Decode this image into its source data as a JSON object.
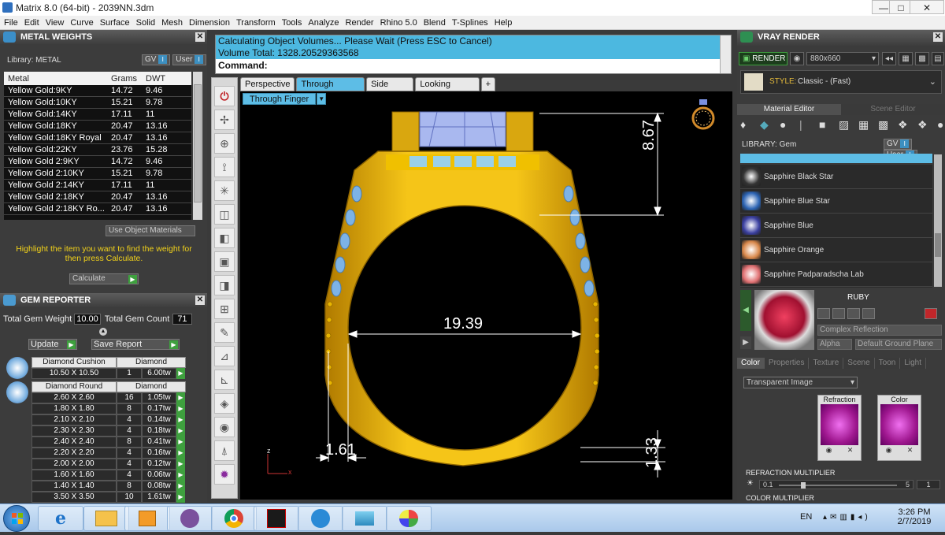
{
  "window": {
    "title": "Matrix 8.0 (64-bit) - 2039NN.3dm",
    "min": "—",
    "max": "□",
    "close": "✕"
  },
  "menu": [
    "File",
    "Edit",
    "View",
    "Curve",
    "Surface",
    "Solid",
    "Mesh",
    "Dimension",
    "Transform",
    "Tools",
    "Analyze",
    "Render",
    "Rhino 5.0",
    "Blend",
    "T-Splines",
    "Help"
  ],
  "metal_weights": {
    "title": "METAL WEIGHTS",
    "library_label": "Library: METAL",
    "gv": "GV",
    "user": "User",
    "headers": [
      "Metal",
      "Grams",
      "DWT"
    ],
    "rows": [
      [
        "Yellow Gold:9KY",
        "14.72",
        "9.46"
      ],
      [
        "Yellow Gold:10KY",
        "15.21",
        "9.78"
      ],
      [
        "Yellow Gold:14KY",
        "17.11",
        "11"
      ],
      [
        "Yellow Gold:18KY",
        "20.47",
        "13.16"
      ],
      [
        "Yellow Gold:18KY Royal",
        "20.47",
        "13.16"
      ],
      [
        "Yellow Gold:22KY",
        "23.76",
        "15.28"
      ],
      [
        "Yellow Gold 2:9KY",
        "14.72",
        "9.46"
      ],
      [
        "Yellow Gold 2:10KY",
        "15.21",
        "9.78"
      ],
      [
        "Yellow Gold 2:14KY",
        "17.11",
        "11"
      ],
      [
        "Yellow Gold 2:18KY",
        "20.47",
        "13.16"
      ],
      [
        "Yellow Gold 2:18KY Ro...",
        "20.47",
        "13.16"
      ]
    ],
    "use_object_materials": "Use Object Materials",
    "hint": "Highlight the item you want to find the weight for then press Calculate.",
    "calculate": "Calculate"
  },
  "gem_reporter": {
    "title": "GEM REPORTER",
    "total_weight_label": "Total Gem Weight",
    "total_weight": "10.00",
    "total_count_label": "Total Gem Count",
    "total_count": "71",
    "update": "Update",
    "save_report": "Save Report",
    "cushion_header": [
      "Diamond Cushion",
      "Diamond"
    ],
    "cushion_row": [
      "10.50 X 10.50",
      "1",
      "6.00tw"
    ],
    "round_header": [
      "Diamond Round",
      "Diamond"
    ],
    "round_rows": [
      [
        "2.60 X 2.60",
        "16",
        "1.05tw"
      ],
      [
        "1.80 X 1.80",
        "8",
        "0.17tw"
      ],
      [
        "2.10 X 2.10",
        "4",
        "0.14tw"
      ],
      [
        "2.30 X 2.30",
        "4",
        "0.18tw"
      ],
      [
        "2.40 X 2.40",
        "8",
        "0.41tw"
      ],
      [
        "2.20 X 2.20",
        "4",
        "0.16tw"
      ],
      [
        "2.00 X 2.00",
        "4",
        "0.12tw"
      ],
      [
        "1.60 X 1.60",
        "4",
        "0.06tw"
      ],
      [
        "1.40 X 1.40",
        "8",
        "0.08tw"
      ],
      [
        "3.50 X 3.50",
        "10",
        "1.61tw"
      ]
    ]
  },
  "command": {
    "line1": "Calculating Object Volumes... Please Wait (Press ESC to Cancel)",
    "line2": "Volume Total: 1328.20529363568",
    "prompt": "Command:"
  },
  "viewport": {
    "tabs": [
      "Perspective",
      "Through Finger",
      "Side View",
      "Looking Down"
    ],
    "add_tab": "+",
    "label": "Through Finger",
    "dims": {
      "top": "8.67",
      "inner": "19.39",
      "left": "1.61",
      "bottom": "1.33"
    },
    "axis_z": "z",
    "axis_x": "x"
  },
  "vray": {
    "title": "VRAY RENDER",
    "render": "RENDER",
    "size": "880x660",
    "style_label": "STYLE:",
    "style_value": "Classic - (Fast)",
    "tab_material": "Material Editor",
    "tab_scene": "Scene Editor",
    "library_label": "LIBRARY: Gem",
    "gv": "GV",
    "user": "User",
    "materials": [
      "Sapphire Black Star",
      "Sapphire Blue Star",
      "Sapphire Blue",
      "Sapphire Orange",
      "Sapphire Padparadscha Lab"
    ],
    "selected_title": "RUBY",
    "complex_reflection": "Complex Reflection",
    "alpha": "Alpha",
    "ground": "Default Ground Plane",
    "prop_tabs": [
      "Color",
      "Properties",
      "Texture",
      "Scene",
      "Toon",
      "Light"
    ],
    "transparent_image": "Transparent Image",
    "refraction": "Refraction",
    "color": "Color",
    "refraction_multiplier": "REFRACTION MULTIPLIER",
    "rm_min": "0.1",
    "rm_max": "5",
    "rm_value": "1",
    "color_multiplier": "COLOR MULTIPLIER"
  },
  "taskbar": {
    "lang": "EN",
    "time": "3:26 PM",
    "date": "2/7/2019"
  }
}
